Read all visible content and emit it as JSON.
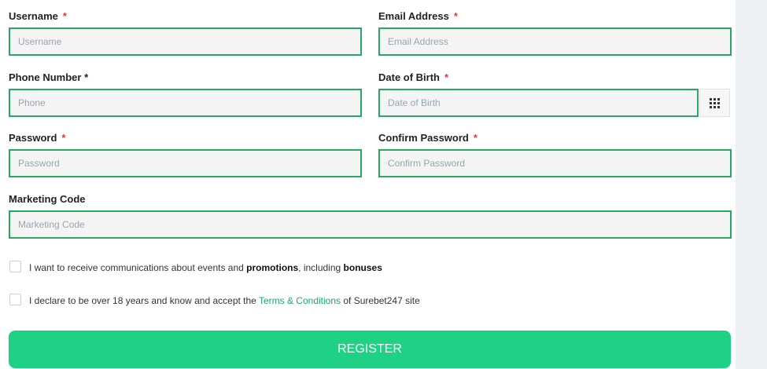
{
  "form": {
    "required_mark": "*",
    "username": {
      "label": "Username",
      "placeholder": "Username",
      "value": ""
    },
    "email": {
      "label": "Email Address",
      "placeholder": "Email Address",
      "value": ""
    },
    "phone": {
      "label": "Phone Number *",
      "placeholder": "Phone",
      "value": ""
    },
    "dob": {
      "label": "Date of Birth",
      "placeholder": "Date of Birth",
      "value": "",
      "picker_icon": "calendar-grid-icon"
    },
    "password": {
      "label": "Password",
      "placeholder": "Password",
      "value": ""
    },
    "confirm_password": {
      "label": "Confirm Password",
      "placeholder": "Confirm Password",
      "value": ""
    },
    "marketing_code": {
      "label": "Marketing Code",
      "placeholder": "Marketing Code",
      "value": ""
    }
  },
  "checkboxes": {
    "communications": {
      "checked": false,
      "text_1": "I want to receive communications about events and ",
      "bold_1": "promotions",
      "text_2": ", including ",
      "bold_2": "bonuses"
    },
    "terms": {
      "checked": false,
      "text_1": "I declare to be over 18 years and know and accept the ",
      "link": "Terms & Conditions",
      "text_2": " of Surebet247 site"
    }
  },
  "register_button": {
    "label": "REGISTER"
  },
  "colors": {
    "accent": "#27a865",
    "button": "#1fd185",
    "required": "#e0383e",
    "link": "#1ea672"
  }
}
